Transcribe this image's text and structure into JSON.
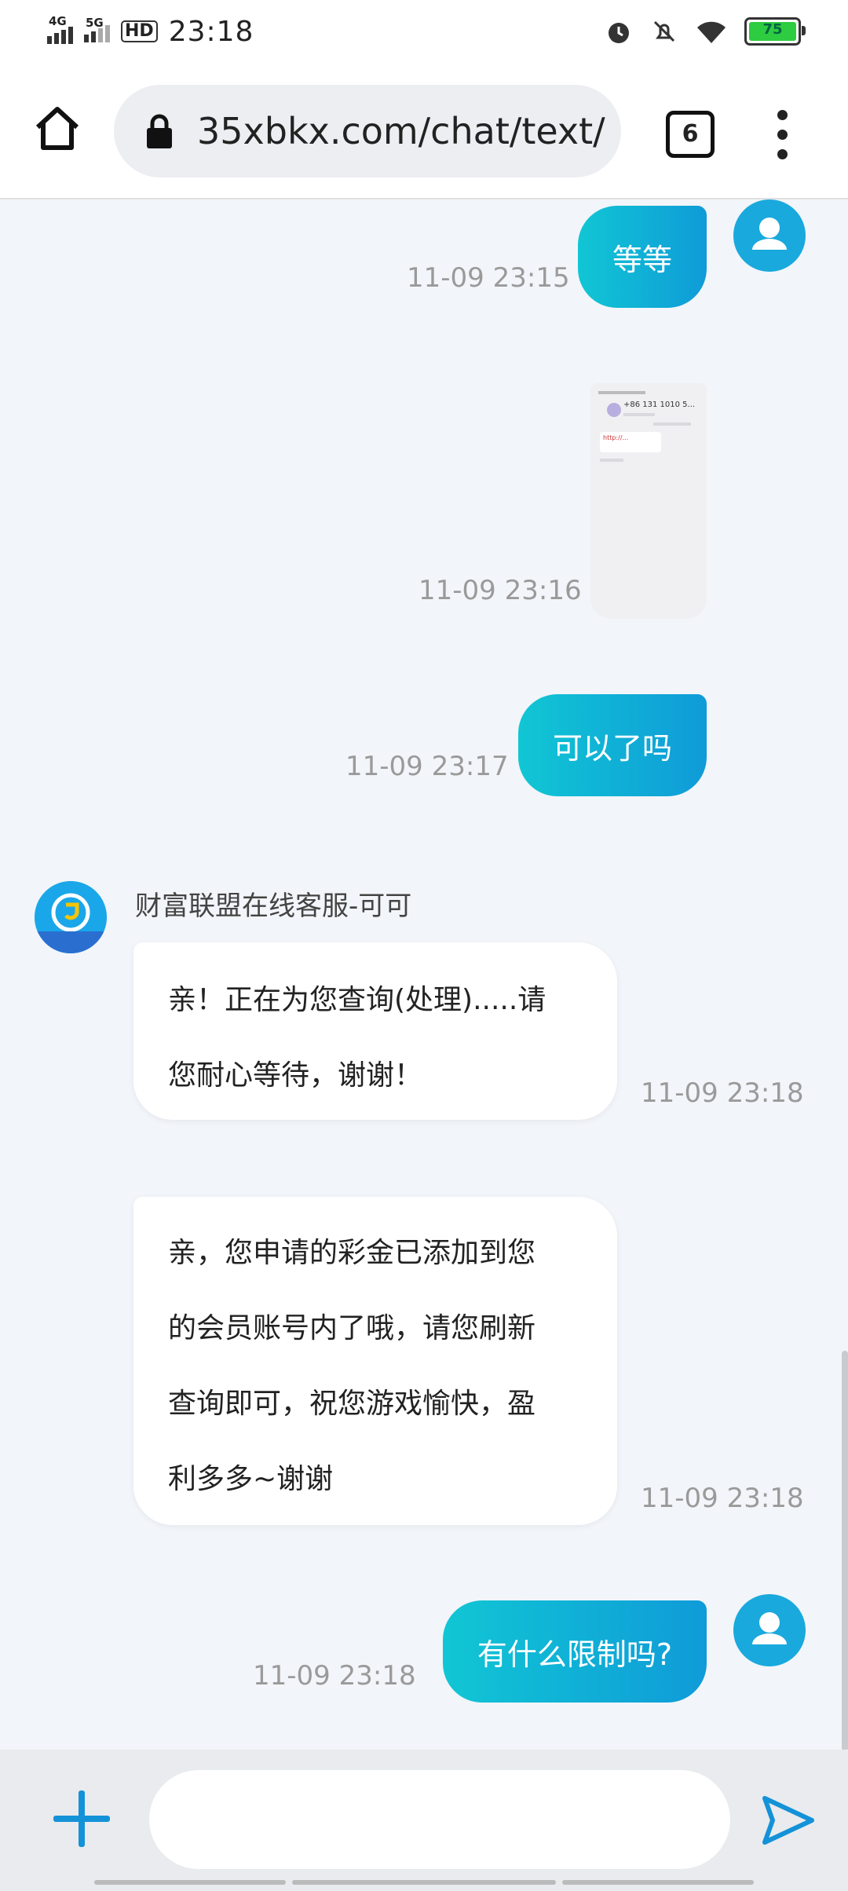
{
  "status_bar": {
    "net1": "4G",
    "net2": "5G",
    "hd": "HD",
    "time": "23:18",
    "battery": "75"
  },
  "browser": {
    "url": "35xbkx.com/chat/text/",
    "tab_count": "6"
  },
  "chat": {
    "agent_name": "财富联盟在线客服-可可",
    "messages": [
      {
        "text": "等等",
        "time": "11-09 23:15"
      },
      {
        "time": "11-09 23:16"
      },
      {
        "text": "可以了吗",
        "time": "11-09 23:17"
      },
      {
        "lines": [
          "亲！正在为您查询(处理).....请",
          "您耐心等待，谢谢！"
        ],
        "time": "11-09 23:18"
      },
      {
        "lines": [
          "亲，您申请的彩金已添加到您",
          "的会员账号内了哦，请您刷新",
          "查询即可，祝您游戏愉快，盈",
          "利多多~谢谢"
        ],
        "time": "11-09 23:18"
      },
      {
        "text": "有什么限制吗?",
        "time": "11-09 23:18"
      }
    ]
  },
  "screenshot_thumb": {
    "phone": "+86 131 1010 5...",
    "link": "http://..."
  },
  "colors": {
    "outgoing_start": "#11c6d4",
    "outgoing_end": "#0f9bd8",
    "accent": "#1492d8",
    "background": "#f2f5f9"
  }
}
